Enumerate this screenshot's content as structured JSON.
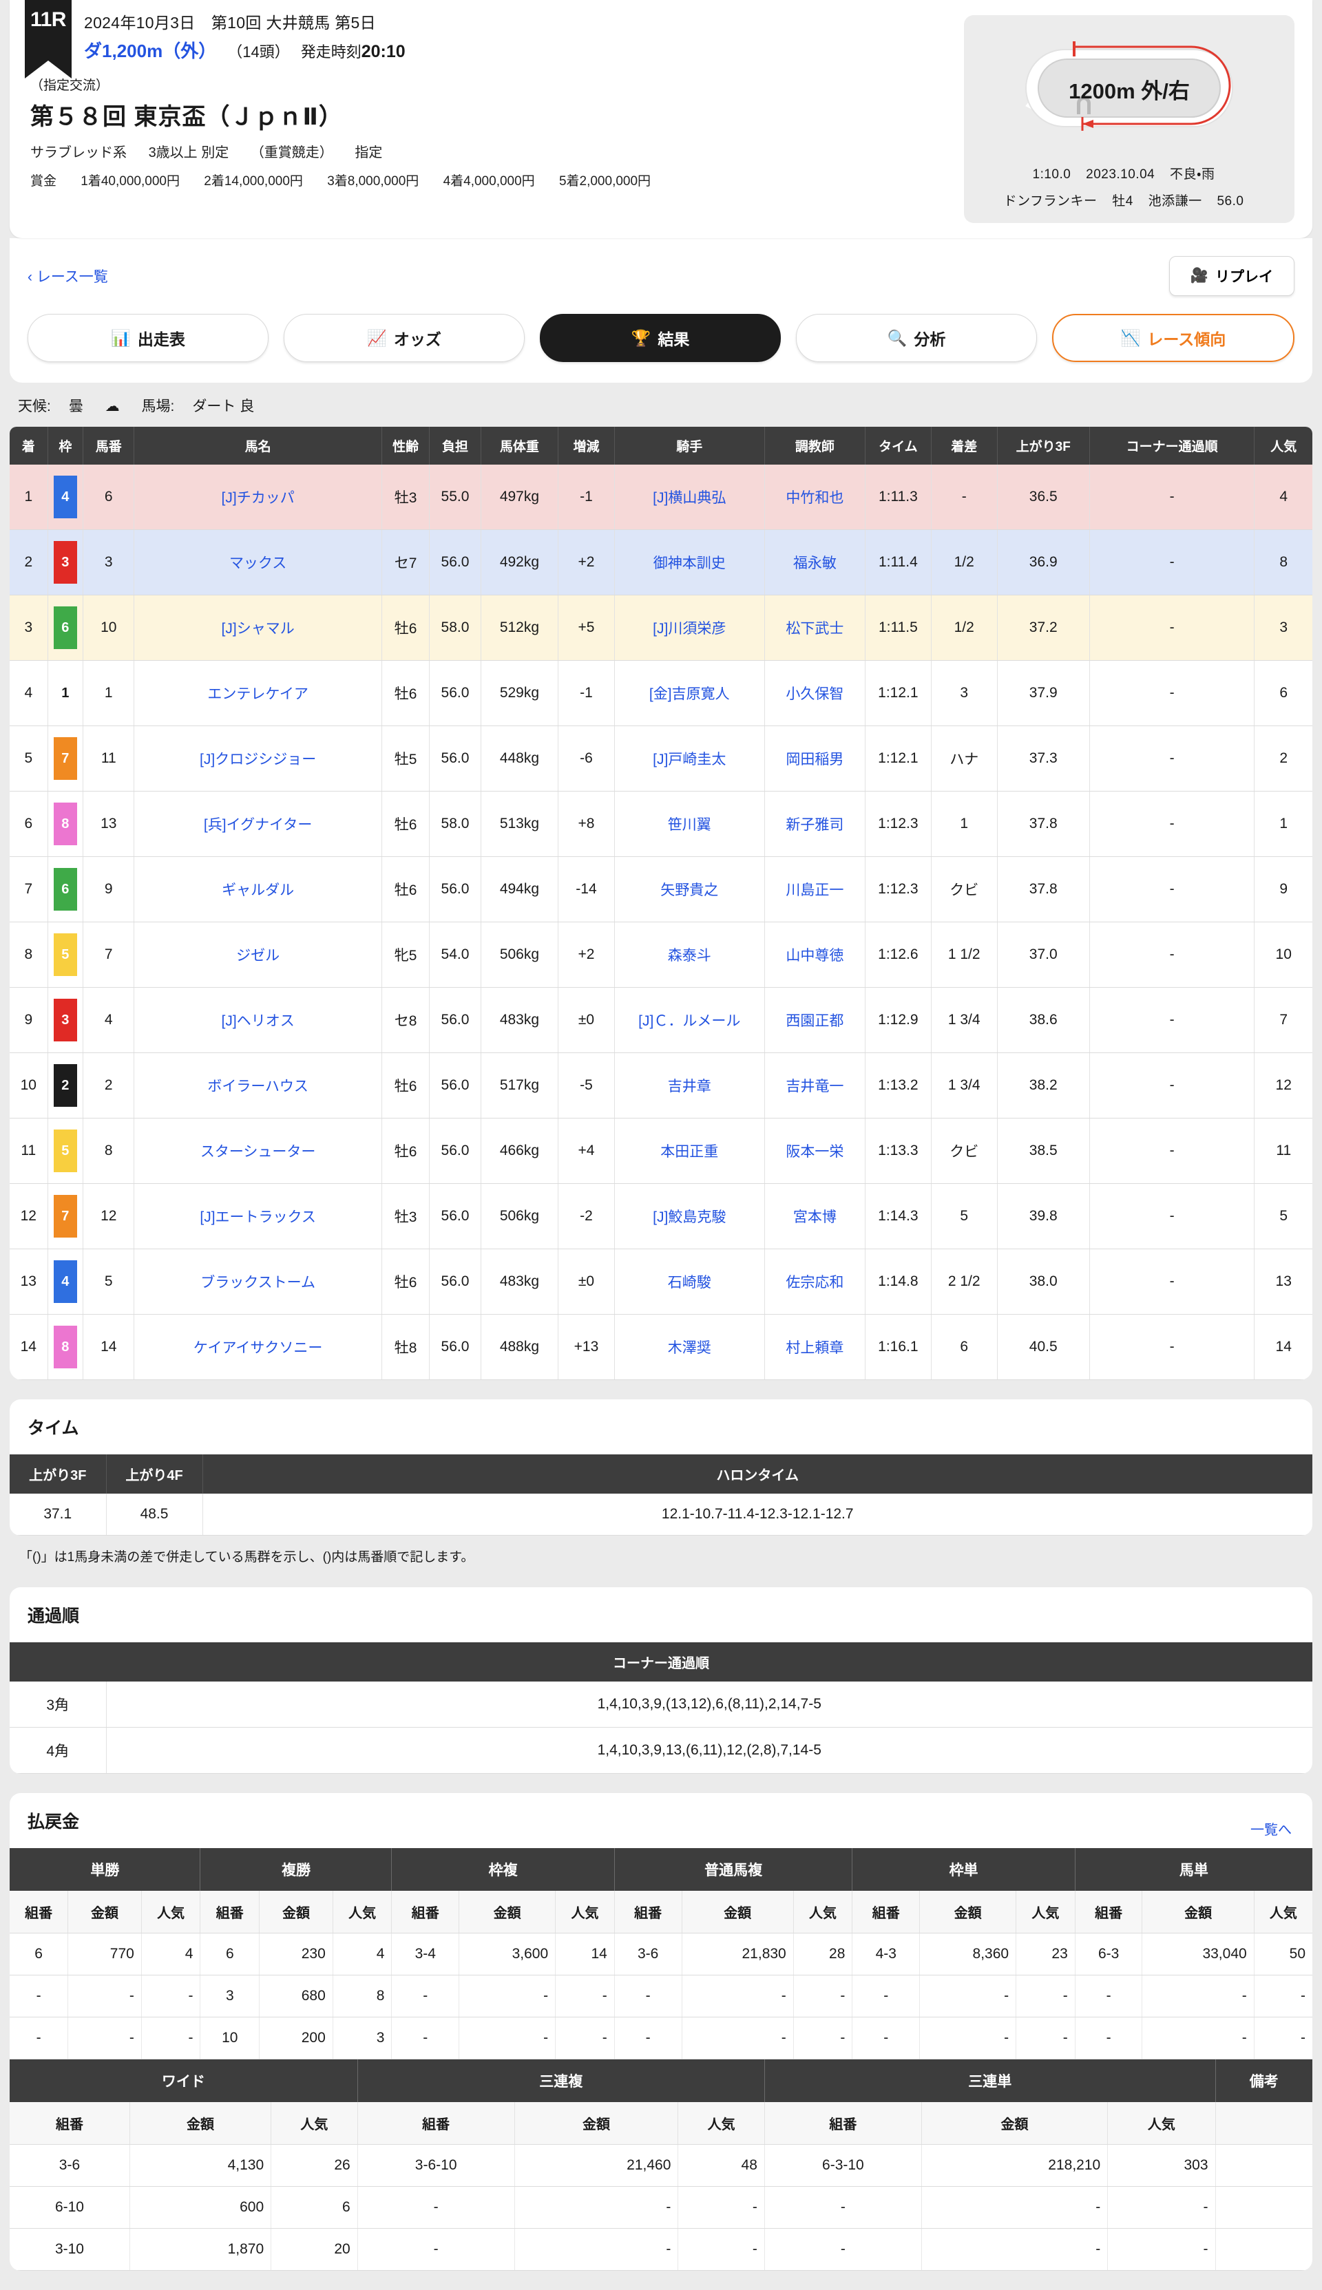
{
  "header": {
    "race_number": "11R",
    "meeting_line": "2024年10月3日　第10回 大井競馬 第5日",
    "surface": "ダ",
    "distance": "1,200m",
    "course_detail": "（外）",
    "field_size": "（14頭）",
    "post_label": "発走時刻",
    "post_time": "20:10",
    "grade_note": "（指定交流）",
    "race_title": "第５８回 東京盃（ＪｐｎⅡ）",
    "conditions": [
      "サラブレッド系",
      "3歳以上 別定",
      "（重賞競走）",
      "指定"
    ],
    "prize_label": "賞金",
    "prizes": [
      "1着40,000,000円",
      "2着14,000,000円",
      "3着8,000,000円",
      "4着4,000,000円",
      "5着2,000,000円"
    ],
    "course_panel": {
      "center_label": "1200m 外/右",
      "record_line": [
        "1:10.0",
        "2023.10.04",
        "不良・雨"
      ],
      "record_horse_line": [
        "ドンフランキー",
        "牡4",
        "池添謙一",
        "56.0"
      ]
    }
  },
  "nav": {
    "back_label": "レース一覧",
    "replay_label": "リプレイ",
    "tabs": [
      {
        "label": "出走表",
        "icon": "table-icon",
        "state": "normal"
      },
      {
        "label": "オッズ",
        "icon": "chart-line-icon",
        "state": "normal"
      },
      {
        "label": "結果",
        "icon": "podium-icon",
        "state": "active"
      },
      {
        "label": "分析",
        "icon": "magnifier-icon",
        "state": "normal"
      },
      {
        "label": "レース傾向",
        "icon": "trend-icon",
        "state": "accent"
      }
    ]
  },
  "conditions_bar": {
    "weather_label": "天候:",
    "weather_value": "曇",
    "track_label": "馬場:",
    "track_value": "ダート 良"
  },
  "result_table": {
    "columns": [
      "着",
      "枠",
      "馬番",
      "馬名",
      "性齢",
      "負担",
      "馬体重",
      "増減",
      "騎手",
      "調教師",
      "タイム",
      "着差",
      "上がり3F",
      "コーナー通過順",
      "人気"
    ],
    "rows": [
      {
        "chaku": "1",
        "waku": "4",
        "waku_color": "#2f6fe0",
        "uma": "6",
        "name": "[J]チカッパ",
        "sei": "牡3",
        "futan": "55.0",
        "bataiju": "497kg",
        "zogen": "-1",
        "kishu": "[J]横山典弘",
        "chokyo": "中竹和也",
        "time": "1:11.3",
        "chakusa": "-",
        "agari": "36.5",
        "corner": "-",
        "ninki": "4"
      },
      {
        "chaku": "2",
        "waku": "3",
        "waku_color": "#e02a25",
        "uma": "3",
        "name": "マックス",
        "sei": "セ7",
        "futan": "56.0",
        "bataiju": "492kg",
        "zogen": "+2",
        "kishu": "御神本訓史",
        "chokyo": "福永敏",
        "time": "1:11.4",
        "chakusa": "1/2",
        "agari": "36.9",
        "corner": "-",
        "ninki": "8"
      },
      {
        "chaku": "3",
        "waku": "6",
        "waku_color": "#3faa48",
        "uma": "10",
        "name": "[J]シャマル",
        "sei": "牡6",
        "futan": "58.0",
        "bataiju": "512kg",
        "zogen": "+5",
        "kishu": "[J]川須栄彦",
        "chokyo": "松下武士",
        "time": "1:11.5",
        "chakusa": "1/2",
        "agari": "37.2",
        "corner": "-",
        "ninki": "3"
      },
      {
        "chaku": "4",
        "waku": "1",
        "waku_color": "#ffffff",
        "uma": "1",
        "name": "エンテレケイア",
        "sei": "牡6",
        "futan": "56.0",
        "bataiju": "529kg",
        "zogen": "-1",
        "kishu": "[金]吉原寛人",
        "chokyo": "小久保智",
        "time": "1:12.1",
        "chakusa": "3",
        "agari": "37.9",
        "corner": "-",
        "ninki": "6"
      },
      {
        "chaku": "5",
        "waku": "7",
        "waku_color": "#f08a22",
        "uma": "11",
        "name": "[J]クロジシジョー",
        "sei": "牡5",
        "futan": "56.0",
        "bataiju": "448kg",
        "zogen": "-6",
        "kishu": "[J]戸崎圭太",
        "chokyo": "岡田稲男",
        "time": "1:12.1",
        "chakusa": "ハナ",
        "agari": "37.3",
        "corner": "-",
        "ninki": "2"
      },
      {
        "chaku": "6",
        "waku": "8",
        "waku_color": "#ec76d0",
        "uma": "13",
        "name": "[兵]イグナイター",
        "sei": "牡6",
        "futan": "58.0",
        "bataiju": "513kg",
        "zogen": "+8",
        "kishu": "笹川翼",
        "chokyo": "新子雅司",
        "time": "1:12.3",
        "chakusa": "1",
        "agari": "37.8",
        "corner": "-",
        "ninki": "1"
      },
      {
        "chaku": "7",
        "waku": "6",
        "waku_color": "#3faa48",
        "uma": "9",
        "name": "ギャルダル",
        "sei": "牡6",
        "futan": "56.0",
        "bataiju": "494kg",
        "zogen": "-14",
        "kishu": "矢野貴之",
        "chokyo": "川島正一",
        "time": "1:12.3",
        "chakusa": "クビ",
        "agari": "37.8",
        "corner": "-",
        "ninki": "9"
      },
      {
        "chaku": "8",
        "waku": "5",
        "waku_color": "#f8cf3f",
        "uma": "7",
        "name": "ジゼル",
        "sei": "牝5",
        "futan": "54.0",
        "bataiju": "506kg",
        "zogen": "+2",
        "kishu": "森泰斗",
        "chokyo": "山中尊徳",
        "time": "1:12.6",
        "chakusa": "1 1/2",
        "agari": "37.0",
        "corner": "-",
        "ninki": "10"
      },
      {
        "chaku": "9",
        "waku": "3",
        "waku_color": "#e02a25",
        "uma": "4",
        "name": "[J]ヘリオス",
        "sei": "セ8",
        "futan": "56.0",
        "bataiju": "483kg",
        "zogen": "±0",
        "kishu": "[J]Ｃ．ルメール",
        "chokyo": "西園正都",
        "time": "1:12.9",
        "chakusa": "1 3/4",
        "agari": "38.6",
        "corner": "-",
        "ninki": "7"
      },
      {
        "chaku": "10",
        "waku": "2",
        "waku_color": "#1c1c1c",
        "uma": "2",
        "name": "ボイラーハウス",
        "sei": "牡6",
        "futan": "56.0",
        "bataiju": "517kg",
        "zogen": "-5",
        "kishu": "吉井章",
        "chokyo": "吉井竜一",
        "time": "1:13.2",
        "chakusa": "1 3/4",
        "agari": "38.2",
        "corner": "-",
        "ninki": "12"
      },
      {
        "chaku": "11",
        "waku": "5",
        "waku_color": "#f8cf3f",
        "uma": "8",
        "name": "スターシューター",
        "sei": "牡6",
        "futan": "56.0",
        "bataiju": "466kg",
        "zogen": "+4",
        "kishu": "本田正重",
        "chokyo": "阪本一栄",
        "time": "1:13.3",
        "chakusa": "クビ",
        "agari": "38.5",
        "corner": "-",
        "ninki": "11"
      },
      {
        "chaku": "12",
        "waku": "7",
        "waku_color": "#f08a22",
        "uma": "12",
        "name": "[J]エートラックス",
        "sei": "牡3",
        "futan": "56.0",
        "bataiju": "506kg",
        "zogen": "-2",
        "kishu": "[J]鮫島克駿",
        "chokyo": "宮本博",
        "time": "1:14.3",
        "chakusa": "5",
        "agari": "39.8",
        "corner": "-",
        "ninki": "5"
      },
      {
        "chaku": "13",
        "waku": "4",
        "waku_color": "#2f6fe0",
        "uma": "5",
        "name": "ブラックストーム",
        "sei": "牡6",
        "futan": "56.0",
        "bataiju": "483kg",
        "zogen": "±0",
        "kishu": "石崎駿",
        "chokyo": "佐宗応和",
        "time": "1:14.8",
        "chakusa": "2 1/2",
        "agari": "38.0",
        "corner": "-",
        "ninki": "13"
      },
      {
        "chaku": "14",
        "waku": "8",
        "waku_color": "#ec76d0",
        "uma": "14",
        "name": "ケイアイサクソニー",
        "sei": "牡8",
        "futan": "56.0",
        "bataiju": "488kg",
        "zogen": "+13",
        "kishu": "木澤奨",
        "chokyo": "村上頼章",
        "time": "1:16.1",
        "chakusa": "6",
        "agari": "40.5",
        "corner": "-",
        "ninki": "14"
      }
    ]
  },
  "time_section": {
    "title": "タイム",
    "columns": [
      "上がり3F",
      "上がり4F",
      "ハロンタイム"
    ],
    "agari3f": "37.1",
    "agari4f": "48.5",
    "halon": "12.1-10.7-11.4-12.3-12.1-12.7",
    "note": "「()」は1馬身未満の差で併走している馬群を示し、()内は馬番順で記します。"
  },
  "corner_section": {
    "title": "通過順",
    "column": "コーナー通過順",
    "rows": [
      {
        "label": "3角",
        "value": "1,4,10,3,9,(13,12),6,(8,11),2,14,7-5"
      },
      {
        "label": "4角",
        "value": "1,4,10,3,9,13,(6,11),12,(2,8),7,14-5"
      }
    ]
  },
  "payout_section": {
    "title": "払戻金",
    "list_link": "一覧へ",
    "sub_headers": [
      "組番",
      "金額",
      "人気"
    ],
    "table1_groups": [
      "単勝",
      "複勝",
      "枠複",
      "普通馬複",
      "枠単",
      "馬単"
    ],
    "table1_rows": [
      [
        {
          "kumi": "6",
          "kin": "770",
          "ninki": "4"
        },
        {
          "kumi": "6",
          "kin": "230",
          "ninki": "4"
        },
        {
          "kumi": "3-4",
          "kin": "3,600",
          "ninki": "14"
        },
        {
          "kumi": "3-6",
          "kin": "21,830",
          "ninki": "28"
        },
        {
          "kumi": "4-3",
          "kin": "8,360",
          "ninki": "23"
        },
        {
          "kumi": "6-3",
          "kin": "33,040",
          "ninki": "50"
        }
      ],
      [
        {
          "kumi": "-",
          "kin": "-",
          "ninki": "-"
        },
        {
          "kumi": "3",
          "kin": "680",
          "ninki": "8"
        },
        {
          "kumi": "-",
          "kin": "-",
          "ninki": "-"
        },
        {
          "kumi": "-",
          "kin": "-",
          "ninki": "-"
        },
        {
          "kumi": "-",
          "kin": "-",
          "ninki": "-"
        },
        {
          "kumi": "-",
          "kin": "-",
          "ninki": "-"
        }
      ],
      [
        {
          "kumi": "-",
          "kin": "-",
          "ninki": "-"
        },
        {
          "kumi": "10",
          "kin": "200",
          "ninki": "3"
        },
        {
          "kumi": "-",
          "kin": "-",
          "ninki": "-"
        },
        {
          "kumi": "-",
          "kin": "-",
          "ninki": "-"
        },
        {
          "kumi": "-",
          "kin": "-",
          "ninki": "-"
        },
        {
          "kumi": "-",
          "kin": "-",
          "ninki": "-"
        }
      ]
    ],
    "table2_groups": [
      "ワイド",
      "三連複",
      "三連単",
      "備考"
    ],
    "table2_rows": [
      [
        {
          "kumi": "3-6",
          "kin": "4,130",
          "ninki": "26"
        },
        {
          "kumi": "3-6-10",
          "kin": "21,460",
          "ninki": "48"
        },
        {
          "kumi": "6-3-10",
          "kin": "218,210",
          "ninki": "303"
        }
      ],
      [
        {
          "kumi": "6-10",
          "kin": "600",
          "ninki": "6"
        },
        {
          "kumi": "-",
          "kin": "-",
          "ninki": "-"
        },
        {
          "kumi": "-",
          "kin": "-",
          "ninki": "-"
        }
      ],
      [
        {
          "kumi": "3-10",
          "kin": "1,870",
          "ninki": "20"
        },
        {
          "kumi": "-",
          "kin": "-",
          "ninki": "-"
        },
        {
          "kumi": "-",
          "kin": "-",
          "ninki": "-"
        }
      ]
    ]
  }
}
